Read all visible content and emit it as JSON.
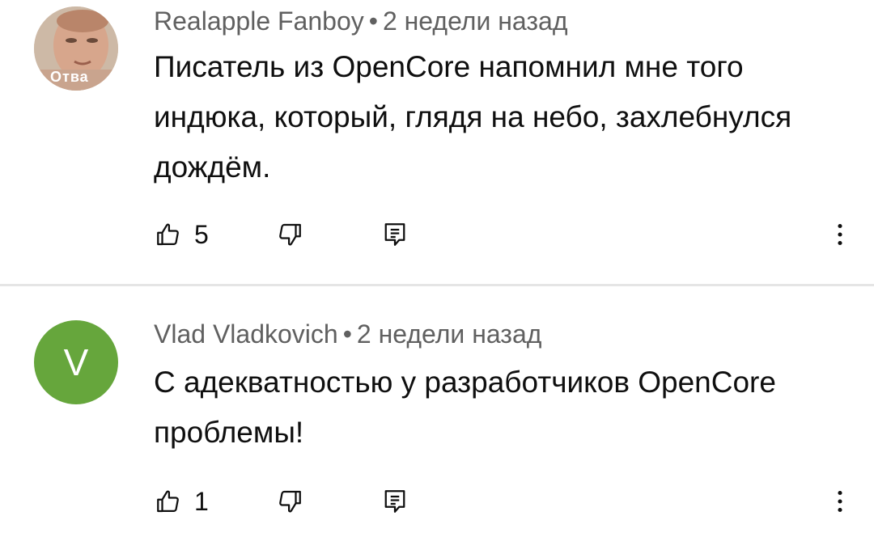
{
  "comments": [
    {
      "author": "Realapple Fanboy",
      "time": "2 недели назад",
      "text": "Писатель из OpenCore напомнил мне того индюка, который, глядя на небо, захлебнулся дождём.",
      "likes": "5",
      "avatar": {
        "type": "photo",
        "badge_text": "Отва"
      }
    },
    {
      "author": "Vlad Vladkovich",
      "time": "2 недели назад",
      "text": "С адекватностью у разработчиков OpenCore проблемы!",
      "likes": "1",
      "avatar": {
        "type": "letter",
        "letter": "V",
        "color": "#66a63c"
      }
    }
  ],
  "separator": "•",
  "icons": {
    "like": "thumbs-up-icon",
    "dislike": "thumbs-down-icon",
    "reply": "reply-icon",
    "more": "more-vertical-icon"
  }
}
